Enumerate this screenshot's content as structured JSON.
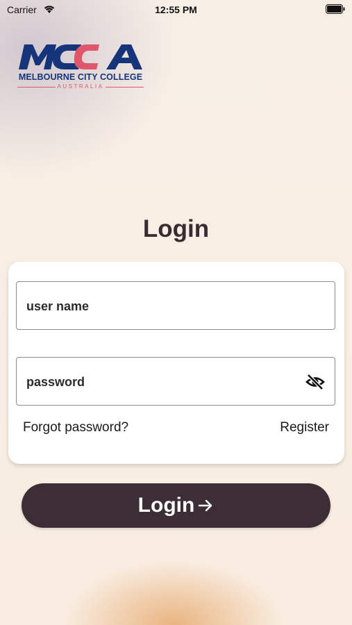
{
  "status_bar": {
    "carrier": "Carrier",
    "time": "12:55 PM"
  },
  "logo": {
    "letters": "MCCA",
    "name": "MELBOURNE CITY COLLEGE",
    "country": "AUSTRALIA"
  },
  "page": {
    "title": "Login"
  },
  "form": {
    "username_placeholder": "user name",
    "password_placeholder": "password",
    "forgot_password": "Forgot password?",
    "register": "Register"
  },
  "login_button": {
    "label": "Login"
  },
  "colors": {
    "brand_blue": "#15347a",
    "brand_red": "#e0566a",
    "button": "#3d2e36"
  },
  "icons": {
    "password_toggle": "eye-off-icon",
    "button_arrow": "arrow-right-icon"
  }
}
